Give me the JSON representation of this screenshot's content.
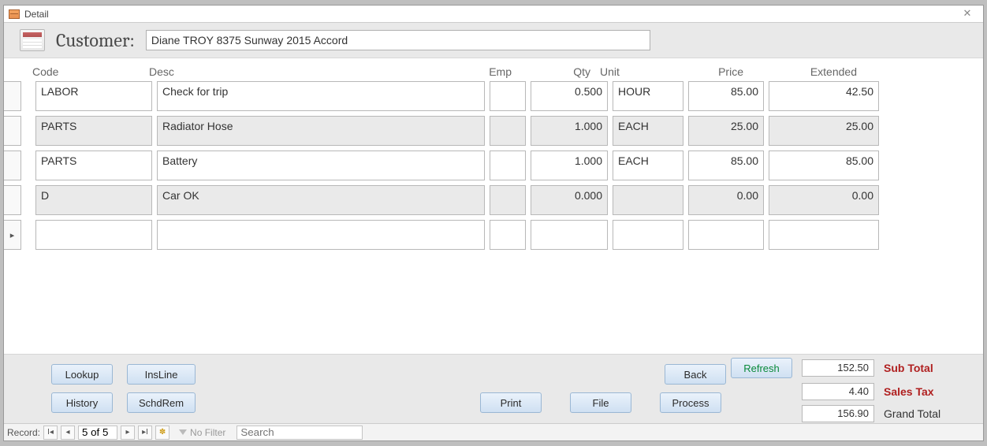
{
  "window": {
    "title": "Detail"
  },
  "header": {
    "label": "Customer:",
    "value": "Diane TROY 8375 Sunway 2015 Accord"
  },
  "columns": {
    "code": "Code",
    "desc": "Desc",
    "emp": "Emp",
    "qty": "Qty",
    "unit": "Unit",
    "price": "Price",
    "ext": "Extended"
  },
  "rows": [
    {
      "code": "LABOR",
      "desc": "Check for trip",
      "emp": "",
      "qty": "0.500",
      "unit": "HOUR",
      "price": "85.00",
      "ext": "42.50",
      "readonly": false
    },
    {
      "code": "PARTS",
      "desc": "Radiator Hose",
      "emp": "",
      "qty": "1.000",
      "unit": "EACH",
      "price": "25.00",
      "ext": "25.00",
      "readonly": true
    },
    {
      "code": "PARTS",
      "desc": "Battery",
      "emp": "",
      "qty": "1.000",
      "unit": "EACH",
      "price": "85.00",
      "ext": "85.00",
      "readonly": false
    },
    {
      "code": "D",
      "desc": "Car OK",
      "emp": "",
      "qty": "0.000",
      "unit": "",
      "price": "0.00",
      "ext": "0.00",
      "readonly": true
    },
    {
      "code": "",
      "desc": "",
      "emp": "",
      "qty": "",
      "unit": "",
      "price": "",
      "ext": "",
      "readonly": false,
      "current": true
    }
  ],
  "buttons": {
    "lookup": "Lookup",
    "insline": "InsLine",
    "history": "History",
    "schdrem": "SchdRem",
    "print": "Print",
    "file": "File",
    "back": "Back",
    "process": "Process",
    "refresh": "Refresh"
  },
  "totals": {
    "subtotal": {
      "label": "Sub Total",
      "value": "152.50"
    },
    "salestax": {
      "label": "Sales Tax",
      "value": "4.40"
    },
    "grandtotal": {
      "label": "Grand Total",
      "value": "156.90"
    }
  },
  "recordnav": {
    "label": "Record:",
    "position": "5 of 5",
    "filter": "No Filter",
    "search_placeholder": "Search"
  }
}
